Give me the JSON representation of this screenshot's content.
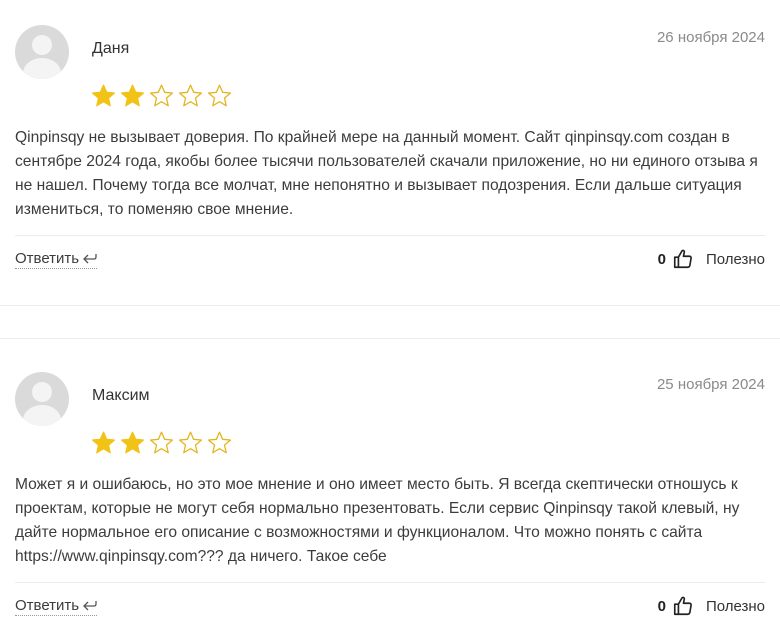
{
  "reviews": [
    {
      "author": "Даня",
      "date": "26 ноября 2024",
      "rating": 2,
      "max_rating": 5,
      "text": "Qinpinsqy не вызывает доверия. По крайней мере на данный момент. Сайт qinpinsqy.com создан в сентябре 2024 года, якобы более тысячи пользователей скачали приложение, но ни единого отзыва я не нашел. Почему тогда все молчат, мне непонятно и вызывает подозрения. Если дальше ситуация измениться, то поменяю свое мнение.",
      "reply_label": "Ответить",
      "useful_count": "0",
      "useful_label": "Полезно"
    },
    {
      "author": "Максим",
      "date": "25 ноября 2024",
      "rating": 2,
      "max_rating": 5,
      "text": "Может я и ошибаюсь, но это мое мнение и оно имеет место быть. Я всегда скептически отношусь к проектам, которые не могут себя нормально презентовать. Если сервис Qinpinsqy такой клевый, ну дайте нормальное его описание с возможностями и функционалом. Что можно понять с сайта https://www.qinpinsqy.com??? да ничего. Такое себе",
      "reply_label": "Ответить",
      "useful_count": "0",
      "useful_label": "Полезно"
    }
  ],
  "colors": {
    "star_filled": "#f2c317",
    "star_empty_stroke": "#e3b520",
    "avatar_bg": "#dadada"
  },
  "icons": {
    "reply": "reply-arrow-icon",
    "thumb": "thumbs-up-icon"
  }
}
